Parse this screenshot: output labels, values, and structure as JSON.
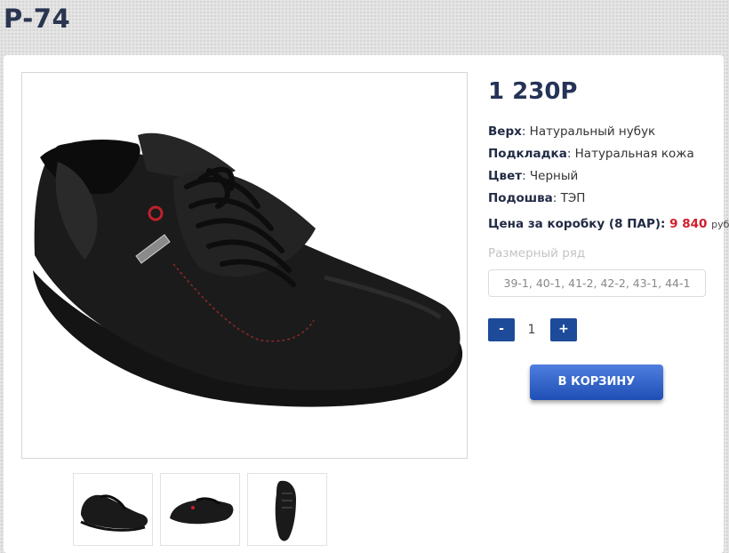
{
  "page": {
    "title": "P-74"
  },
  "product": {
    "price": "1 230Р",
    "specs": [
      {
        "label": "Верх",
        "value": "Натуральный нубук"
      },
      {
        "label": "Подкладка",
        "value": "Натуральная кожа"
      },
      {
        "label": "Цвет",
        "value": "Черный"
      },
      {
        "label": "Подошва",
        "value": "ТЭП"
      }
    ],
    "box_price_label": "Цена за коробку (8 ПАР):",
    "box_price_value": "9 840",
    "box_price_currency": "руб",
    "size_label": "Размерный ряд",
    "size_range": "39-1, 40-1, 41-2, 42-2, 43-1, 44-1",
    "quantity": "1",
    "minus_label": "-",
    "plus_label": "+",
    "add_to_cart_label": "В КОРЗИНУ"
  },
  "icons": {
    "main_image": "shoe-photo",
    "thumbnails": [
      "shoe-thumbnail-front",
      "shoe-thumbnail-side",
      "shoe-thumbnail-top"
    ]
  },
  "colors": {
    "title": "#2a3550",
    "accent_blue": "#1e4a9a",
    "price_red": "#d01f2c"
  }
}
